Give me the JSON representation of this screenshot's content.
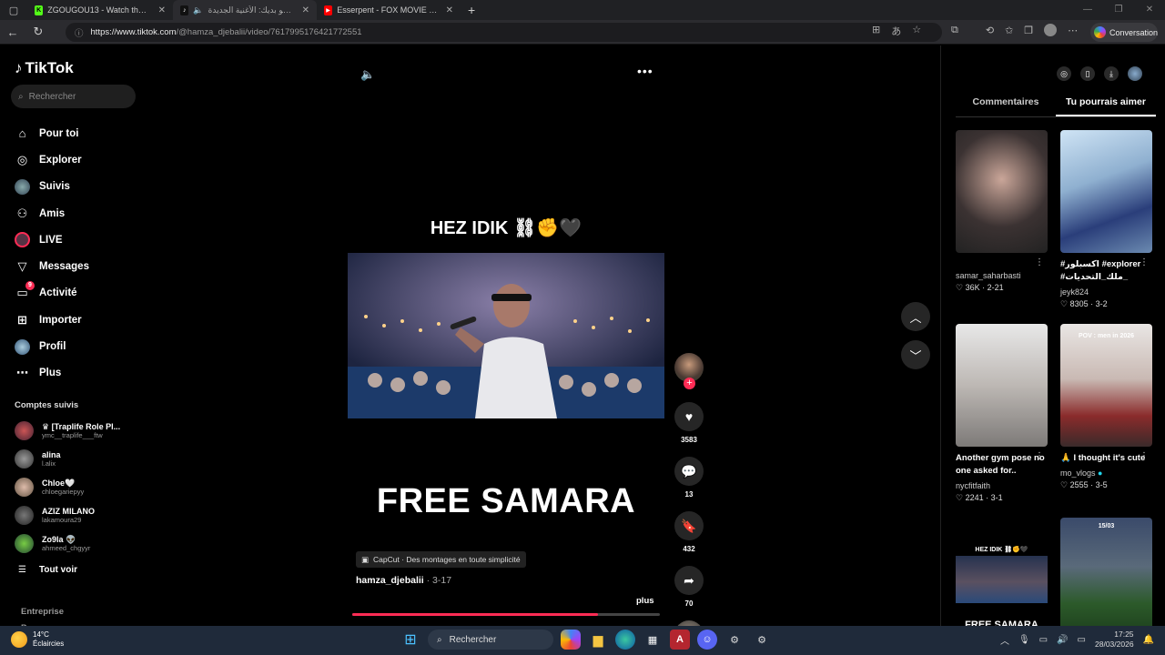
{
  "browser": {
    "tabs": [
      {
        "title": "ZGOUGOU13 - Watch the VOD o",
        "icon": "kick-icon",
        "icon_color": "#53fc18",
        "icon_text": "K"
      },
      {
        "title": "ساماا هو بديك: الأغنية الجديدة",
        "icon": "tiktok-icon",
        "icon_color": "#000000",
        "icon_text": "♪",
        "active": true
      },
      {
        "title": "Esserpent - FOX MOVIE ( officiel",
        "icon": "youtube-icon",
        "icon_color": "#ff0000",
        "icon_text": "▶"
      }
    ],
    "url_domain": "https://www.tiktok.com",
    "url_path": "/@hamza_djebalii/video/7617995176421772551",
    "conversation_label": "Conversation"
  },
  "sidebar": {
    "brand": "TikTok",
    "search_placeholder": "Rechercher",
    "nav": [
      {
        "label": "Pour toi",
        "icon": "home-icon"
      },
      {
        "label": "Explorer",
        "icon": "compass-icon"
      },
      {
        "label": "Suivis",
        "icon": "following-icon"
      },
      {
        "label": "Amis",
        "icon": "friends-icon"
      },
      {
        "label": "LIVE",
        "icon": "live-icon"
      },
      {
        "label": "Messages",
        "icon": "messages-icon"
      },
      {
        "label": "Activité",
        "icon": "activity-icon",
        "badge": "9"
      },
      {
        "label": "Importer",
        "icon": "upload-icon"
      },
      {
        "label": "Profil",
        "icon": "profile-icon"
      },
      {
        "label": "Plus",
        "icon": "more-icon"
      }
    ],
    "following_header": "Comptes suivis",
    "following": [
      {
        "name": "♛ [Traplife Role Pl...",
        "handle": "ymc__traplife___ftw"
      },
      {
        "name": "alina",
        "handle": "l.alix"
      },
      {
        "name": "Chloe🤍",
        "handle": "chloegariepyy"
      },
      {
        "name": "AZIZ MILANO",
        "handle": "lakamoura29"
      },
      {
        "name": "Zo9la 👽",
        "handle": "ahmeed_chgyyr"
      }
    ],
    "see_all": "Tout voir",
    "footer": [
      "Entreprise",
      "Programme"
    ]
  },
  "video": {
    "caption_top": "HEZ IDIK ⛓✊🖤",
    "caption_big": "FREE SAMARA",
    "capcut_label": "CapCut · Des montages en toute simplicité",
    "author": "hamza_djebalii",
    "date": " · 3-17",
    "more_label": "plus",
    "progress": 0.8,
    "likes": "3583",
    "comments": "13",
    "saves": "432",
    "shares": "70"
  },
  "right_panel": {
    "tabs": [
      "Commentaires",
      "Tu pourrais aimer"
    ],
    "active_tab": 1,
    "cards": [
      {
        "title": "",
        "user": "samar_saharbasti",
        "likes": "36K",
        "date": "2-21"
      },
      {
        "title": "#اكسبلور #explorer #ملك_التحديات_",
        "user": "jeyk824",
        "likes": "8305",
        "date": "3-2"
      },
      {
        "title": "Another gym pose no one asked for..",
        "user": "nycfitfaith",
        "likes": "2241",
        "date": "3-1"
      },
      {
        "title": "🙏 I thought it's cute",
        "user": "mo_vlogs",
        "likes": "2555",
        "date": "3-5"
      },
      {
        "title": "",
        "overlay": "HEZ IDIK ⛓✊🖤",
        "bottom_text": "FREE SAMARA",
        "user": "",
        "likes": "",
        "date": ""
      },
      {
        "title": "",
        "overlay": "15/03",
        "user": "",
        "likes": "",
        "date": ""
      }
    ],
    "overlay_pov": "POV : men in 2026"
  },
  "taskbar": {
    "temp": "14°C",
    "weather": "Éclaircies",
    "search": "Rechercher",
    "time": "17:25",
    "date": "28/03/2026"
  },
  "colors": {
    "accent": "#fe2c55",
    "bg": "#000000"
  }
}
